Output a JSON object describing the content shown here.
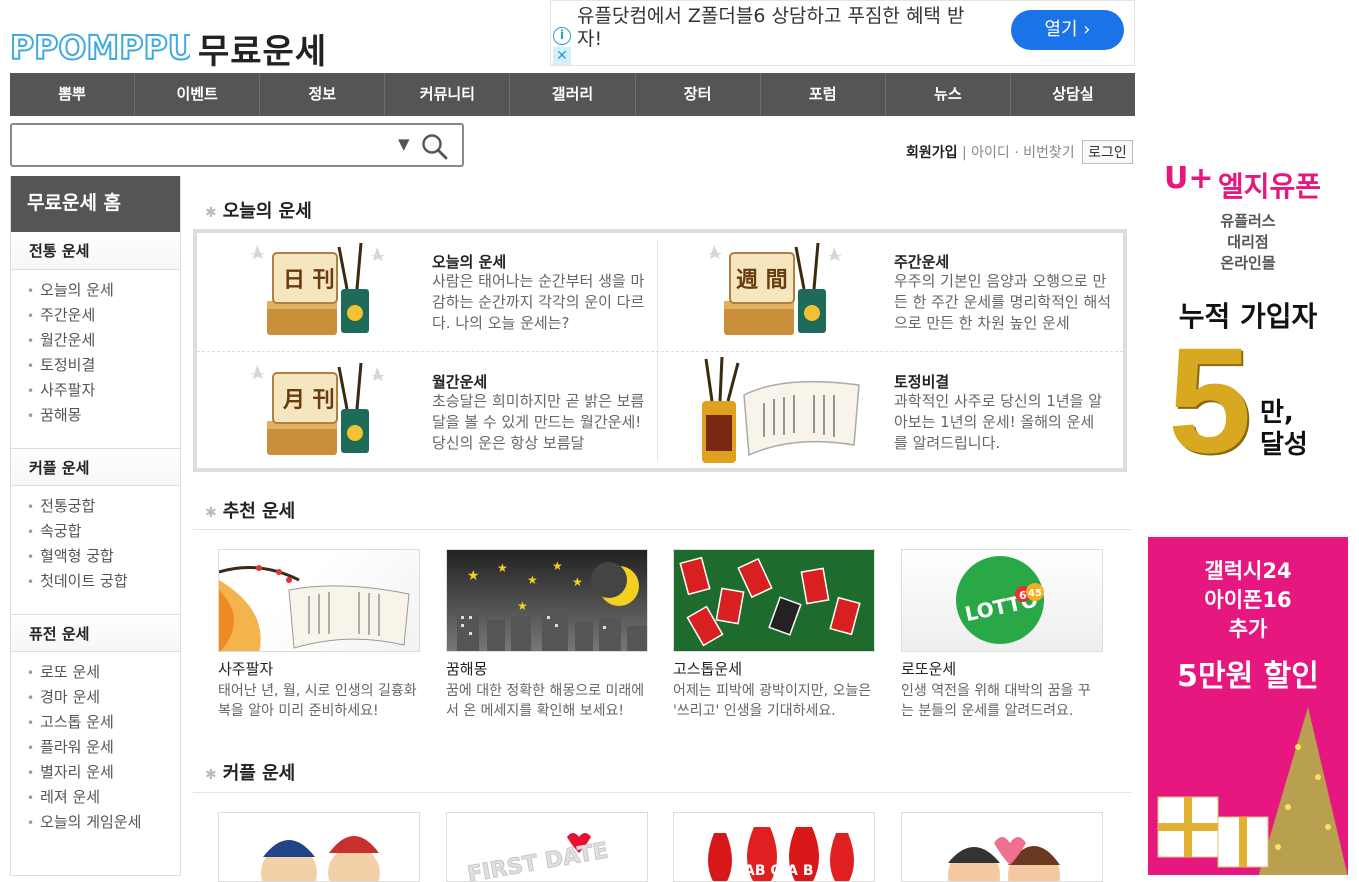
{
  "header": {
    "logo_text": "PPOMPPU",
    "title": "무료운세"
  },
  "top_ad": {
    "text": "유플닷컴에서 Z폴더블6 상담하고 푸짐한 혜택 받자!",
    "info_icon": "info-icon",
    "close_icon": "close-icon",
    "open_button": "열기 ›",
    "colors": {
      "button": "#1a73e8"
    }
  },
  "nav": {
    "items": [
      "뽐뿌",
      "이벤트",
      "정보",
      "커뮤니티",
      "갤러리",
      "장터",
      "포럼",
      "뉴스",
      "상담실"
    ]
  },
  "search": {
    "dropdown_glyph": "▼",
    "icon": "search-icon"
  },
  "member": {
    "join": "회원가입",
    "sep1": "|",
    "find_id": "아이디",
    "dot": "·",
    "find_pw": "비번찾기",
    "login": "로그인"
  },
  "sidebar": {
    "home": "무료운세 홈",
    "sections": [
      {
        "title": "전통 운세",
        "items": [
          "오늘의 운세",
          "주간운세",
          "월간운세",
          "토정비결",
          "사주팔자",
          "꿈해몽"
        ]
      },
      {
        "title": "커플 운세",
        "items": [
          "전통궁합",
          "속궁합",
          "혈액형 궁합",
          "첫데이트 궁합"
        ]
      },
      {
        "title": "퓨전 운세",
        "items": [
          "로또 운세",
          "경마 운세",
          "고스톱 운세",
          "플라워 운세",
          "별자리 운세",
          "레져 운세",
          "오늘의 게임운세"
        ]
      }
    ]
  },
  "today": {
    "heading": "오늘의 운세",
    "items": [
      {
        "title": "오늘의 운세",
        "desc": "사람은 태어나는 순간부터 생을 마감하는 순간까지 각각의 운이 다르다. 나의 오늘 운세는?",
        "img_label": "日 刊"
      },
      {
        "title": "주간운세",
        "desc": "우주의 기본인 음양과 오행으로 만든 한 주간 운세를 명리학적인 해석으로 만든 한 차원 높인 운세",
        "img_label": "週 間"
      },
      {
        "title": "월간운세",
        "desc": "초승달은 희미하지만 곧 밝은 보름달을 볼 수 있게 만드는 월간운세! 당신의 운은 항상 보름달",
        "img_label": "月 刊"
      },
      {
        "title": "토정비결",
        "desc": "과학적인 사주로 당신의 1년을 알아보는 1년의 운세! 올해의 운세를 알려드립니다.",
        "img_label": ""
      }
    ]
  },
  "recommend": {
    "heading": "추천 운세",
    "cards": [
      {
        "title": "사주팔자",
        "desc": "태어난 년, 월, 시로 인생의 길흉화복을 알아 미리 준비하세요!"
      },
      {
        "title": "꿈해몽",
        "desc": "꿈에 대한 정확한 해몽으로 미래에서 온 메세지를 확인해 보세요!"
      },
      {
        "title": "고스톱운세",
        "desc": "어제는 피박에 광박이지만, 오늘은 '쓰리고' 인생을 기대하세요."
      },
      {
        "title": "로또운세",
        "desc": "인생 역전을 위해 대박의 꿈을 꾸는 분들의 운세를 알려드려요."
      }
    ],
    "lotto_label": "LOTTO",
    "lotto_num": "6",
    "lotto_num2": "45"
  },
  "couple": {
    "heading": "커플 운세",
    "card2_text": "FIRST DATE",
    "card3_text": "AB O A B"
  },
  "right_ad": {
    "brand_plus": "U+",
    "brand": "엘지유폰",
    "sub1": "유플러스",
    "sub2": "대리점",
    "sub3": "온라인몰",
    "headline": "누적 가입자",
    "big_num": "5",
    "unit1": "만,",
    "unit2": "달성",
    "promo1": "갤럭시24",
    "promo2": "아이폰16",
    "promo3": "추가",
    "promo4": "5만원 할인",
    "colors": {
      "magenta": "#e6177f",
      "gold": "#d8a820"
    }
  },
  "colors": {
    "nav_bg": "#555555",
    "accent_blue": "#1a73e8"
  }
}
